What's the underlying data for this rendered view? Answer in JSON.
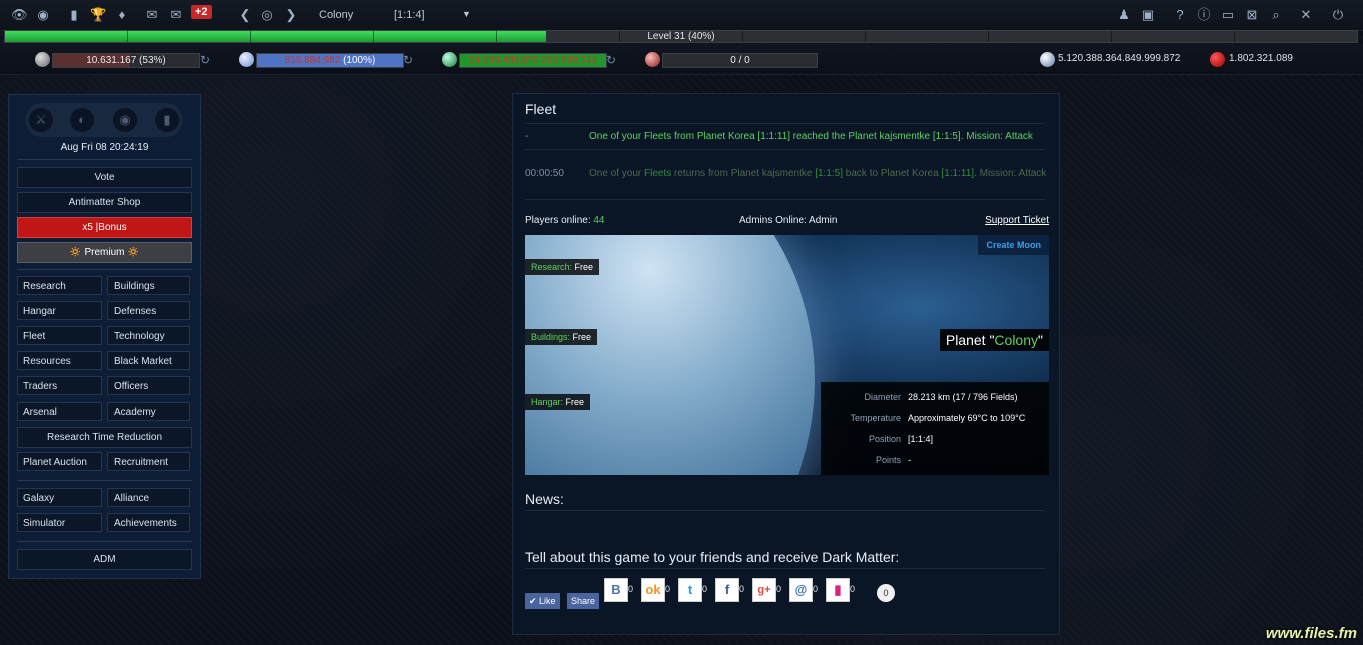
{
  "topbar": {
    "icons_left": [
      "eye-icon",
      "globe-icon",
      "stats-icon",
      "trophy-icon",
      "medal-icon",
      "chat-icon",
      "messages-icon"
    ],
    "messages_badge": "+2",
    "planet_name": "Colony",
    "planet_coords": "[1:1:4]",
    "icons_right": [
      "people-icon",
      "book-icon",
      "help-icon",
      "info-icon",
      "screen-icon",
      "close-box-icon",
      "search-icon",
      "tools-icon",
      "power-icon"
    ]
  },
  "level": {
    "text": "Level 31 (40%)",
    "progress_percent": 40
  },
  "resources": {
    "metal": {
      "value": "10.631.167 (53%)",
      "percent": 53,
      "color": "#5a3030"
    },
    "crystal": {
      "value": "815.884.982 (100%)",
      "percent": 100,
      "color": "#4f74c6"
    },
    "deuterium": {
      "value": "24.999.489.879.299.999.744",
      "percent": 100,
      "color": "#21962d"
    },
    "energy": {
      "value": "0 / 0",
      "percent": 0
    },
    "dark_matter": {
      "value": "5.120.388.364.849.999.872"
    },
    "antimatter": {
      "value": "1.802.321.089"
    }
  },
  "sidebar": {
    "circles": [
      "sword-icon",
      "lightning-icon",
      "eye-icon",
      "pin-icon"
    ],
    "clock": "Aug Fri 08 20:24:19",
    "vote": "Vote",
    "shop": "Antimatter Shop",
    "bonus": "x5 |Bonus",
    "premium": "🔅 Premium 🔅",
    "nav": [
      [
        "Research",
        "Buildings"
      ],
      [
        "Hangar",
        "Defenses"
      ],
      [
        "Fleet",
        "Technology"
      ],
      [
        "Resources",
        "Black Market"
      ],
      [
        "Traders",
        "Officers"
      ],
      [
        "Arsenal",
        "Academy"
      ]
    ],
    "research_time": "Research Time Reduction",
    "nav2": [
      [
        "Planet Auction",
        "Recruitment"
      ]
    ],
    "nav3": [
      [
        "Galaxy",
        "Alliance"
      ],
      [
        "Simulator",
        "Achievements"
      ]
    ],
    "adm": "ADM"
  },
  "main": {
    "fleet_title": "Fleet",
    "fleet_events": [
      {
        "time": "-",
        "parts": [
          "One of your Fleets from Planet Korea [1:1:11] reached the Planet kajsmentke [1:1:5]. Mission: Attack"
        ]
      },
      {
        "time": "00:00:50",
        "p1": "One of your ",
        "p2": "Fleets",
        "p3": " returns from Planet kajsmentke ",
        "p4": "[1:1:5]",
        "p5": " back to Planet Korea ",
        "p6": "[1:1:11]",
        "p7": ". Mission: Attack"
      }
    ],
    "players_online_label": "Players online:",
    "players_online": "44",
    "admins_online": "Admins Online: Admin",
    "support_ticket": "Support Ticket",
    "create_moon": "Create Moon",
    "tags": [
      {
        "label": "Research:",
        "value": " Free"
      },
      {
        "label": "Buildings:",
        "value": " Free"
      },
      {
        "label": "Hangar:",
        "value": " Free"
      }
    ],
    "planet_title_prefix": "Planet \"",
    "planet_title_name": "Colony",
    "planet_title_suffix": "\"",
    "info": [
      {
        "k": "Diameter",
        "v": "28.213 km (17 / 796 Fields)"
      },
      {
        "k": "Temperature",
        "v": "Approximately 69°C to 109°C"
      },
      {
        "k": "Position",
        "v": "[1:1:4]"
      },
      {
        "k": "Points",
        "v": "-"
      }
    ],
    "news_title": "News:",
    "share_title": "Tell about this game to your friends and receive Dark Matter:",
    "like": "✔ Like",
    "share": "Share",
    "socials": [
      {
        "name": "vk-icon",
        "glyph": "B",
        "color": "#4a76a8",
        "count": "0"
      },
      {
        "name": "odnoklassniki-icon",
        "glyph": "ok",
        "color": "#f7931e",
        "count": "0"
      },
      {
        "name": "twitter-icon",
        "glyph": "t",
        "color": "#1da1f2",
        "count": "0"
      },
      {
        "name": "facebook-icon",
        "glyph": "f",
        "color": "#3b5998",
        "count": "0"
      },
      {
        "name": "googleplus-icon",
        "glyph": "g+",
        "color": "#dd4b39",
        "count": "0"
      },
      {
        "name": "email-icon",
        "glyph": "@",
        "color": "#2f6fb4",
        "count": "0"
      },
      {
        "name": "bookmark-icon",
        "glyph": "▮",
        "color": "#e0207a",
        "count": "0"
      }
    ],
    "bubble": "0"
  },
  "watermark": "www.files.fm"
}
